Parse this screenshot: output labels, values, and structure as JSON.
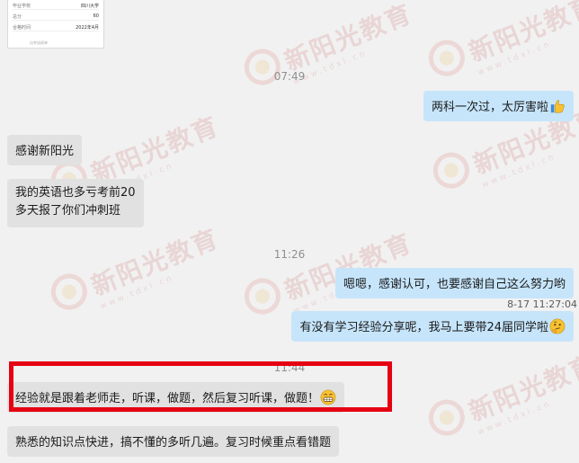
{
  "thumbnail": {
    "rows": [
      {
        "label": "毕业学校",
        "value": "四川大学"
      },
      {
        "label": "总分",
        "value": "60"
      },
      {
        "label": "合格时间",
        "value": "2022年4月"
      }
    ],
    "footer": "自考成绩单"
  },
  "watermark": {
    "brand": "新阳光教育",
    "url": "www.tdxl.cn"
  },
  "messages": {
    "time_1": "07:49",
    "out_1": "两科一次过，太厉害啦",
    "in_1": "感谢新阳光",
    "in_2_line1": "我的英语也多亏考前20",
    "in_2_line2": "多天报了你们冲刺班",
    "time_2": "11:26",
    "out_2": "嗯嗯，感谢认可，也要感谢自己这么努力哟",
    "read_stamp": "8-17 11:27:04",
    "out_3": "有没有学习经验分享呢，我马上要带24届同学啦",
    "time_3": "11:44",
    "in_3": "经验就是跟着老师走，听课，做题，然后复习听课，做题！",
    "in_4": "熟悉的知识点快进，搞不懂的多听几遍。复习时候重点看错题"
  },
  "icons": {
    "thumbs_up": "thumbs-up-emoji",
    "thinking": "thinking-face-emoji",
    "grin": "grinning-face-emoji"
  },
  "colors": {
    "background": "#f1f1f1",
    "incoming_bubble": "#e1e1e1",
    "outgoing_bubble": "#c6e5fb",
    "highlight_border": "#e60012"
  }
}
